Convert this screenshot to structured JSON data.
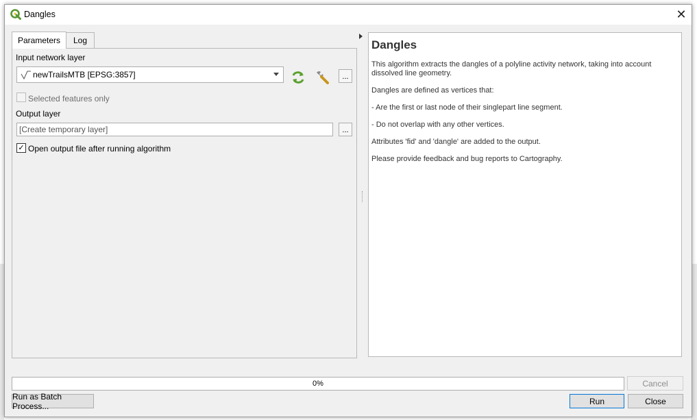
{
  "window": {
    "title": "Dangles",
    "close_symbol": "✕"
  },
  "tabs": [
    {
      "label": "Parameters",
      "active": true
    },
    {
      "label": "Log",
      "active": false
    }
  ],
  "parameters": {
    "input_label": "Input network layer",
    "input_value": "newTrailsMTB [EPSG:3857]",
    "selected_only_label": "Selected features only",
    "selected_only_checked": false,
    "output_label": "Output layer",
    "output_placeholder": "[Create temporary layer]",
    "open_output_label": "Open output file after running algorithm",
    "open_output_checked": true,
    "browse_label": "..."
  },
  "help": {
    "title": "Dangles",
    "paragraphs": [
      "This algorithm extracts the dangles of a polyline activity network, taking into account dissolved line geometry.",
      "Dangles are defined as vertices that:",
      "- Are the first or last node of their singlepart line segment.",
      "- Do not overlap with any other vertices.",
      "Attributes 'fid' and 'dangle' are added to the output.",
      "Please provide feedback and bug reports to Cartography."
    ]
  },
  "footer": {
    "progress_percent": 0,
    "progress_label": "0%",
    "cancel_label": "Cancel",
    "batch_label": "Run as Batch Process...",
    "run_label": "Run",
    "close_label": "Close"
  },
  "colors": {
    "qgis_green": "#589632",
    "iterate_green": "#5aa02c",
    "default_button_border": "#0078d7"
  }
}
